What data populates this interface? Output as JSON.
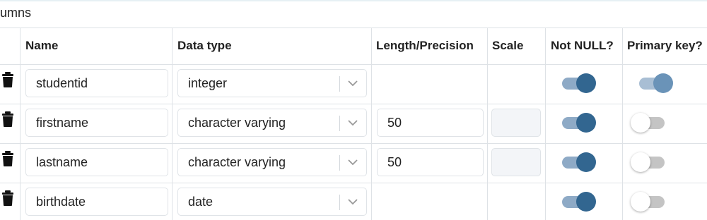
{
  "section": {
    "title": "umns"
  },
  "headers": {
    "name": "Name",
    "data_type": "Data type",
    "length": "Length/Precision",
    "scale": "Scale",
    "not_null": "Not NULL?",
    "primary_key": "Primary key?"
  },
  "rows": [
    {
      "name": "studentid",
      "data_type": "integer",
      "length": "",
      "scale_editable": false,
      "not_null": true,
      "primary_key": true,
      "primary_key_disabled": true
    },
    {
      "name": "firstname",
      "data_type": "character varying",
      "length": "50",
      "scale_editable": true,
      "not_null": true,
      "primary_key": false
    },
    {
      "name": "lastname",
      "data_type": "character varying",
      "length": "50",
      "scale_editable": true,
      "not_null": true,
      "primary_key": false
    },
    {
      "name": "birthdate",
      "data_type": "date",
      "length": "",
      "scale_editable": false,
      "not_null": true,
      "primary_key": false
    }
  ],
  "icons": {
    "delete": "trash-icon",
    "dropdown": "chevron-down-icon"
  },
  "colors": {
    "toggle_on_knob": "#326690",
    "toggle_on_track": "#8eaac6",
    "toggle_off_track": "#c4c4c4",
    "border": "#dee2e6",
    "disabled_field": "#f3f5f8"
  }
}
